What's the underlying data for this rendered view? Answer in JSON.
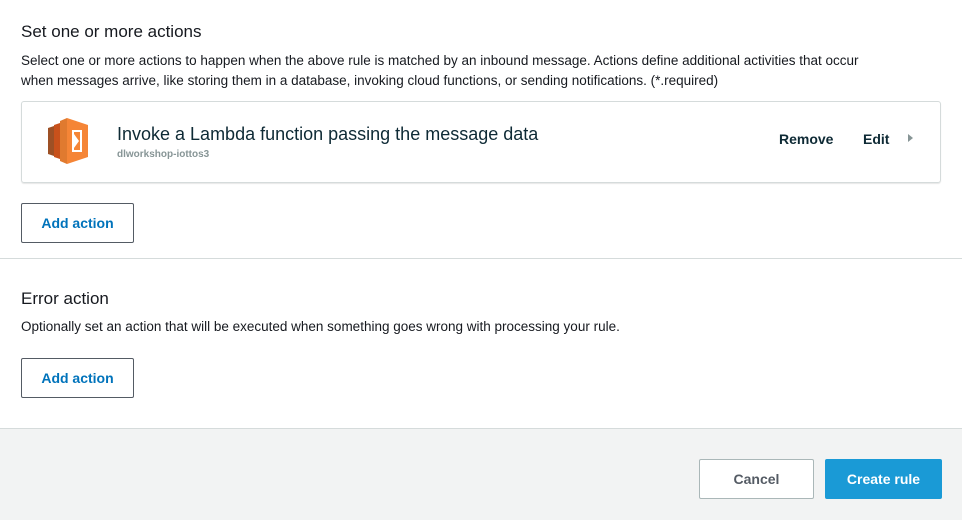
{
  "actions_section": {
    "heading": "Set one or more actions",
    "description_line1": "Select one or more actions to happen when the above rule is matched by an inbound message. Actions define additional activities that occur",
    "description_line2": "when messages arrive, like storing them in a database, invoking cloud functions, or sending notifications. (*.required)",
    "action_card": {
      "icon": "lambda-icon",
      "title": "Invoke a Lambda function passing the message data",
      "subtitle": "dlworkshop-iottos3",
      "remove_label": "Remove",
      "edit_label": "Edit"
    },
    "add_action_label": "Add action"
  },
  "error_section": {
    "heading": "Error action",
    "description": "Optionally set an action that will be executed when something goes wrong with processing your rule.",
    "add_action_label": "Add action"
  },
  "footer": {
    "cancel_label": "Cancel",
    "create_label": "Create rule"
  },
  "colors": {
    "accent": "#0073bb",
    "primary_button": "#1a9ad6",
    "lambda_orange": "#f58536"
  }
}
